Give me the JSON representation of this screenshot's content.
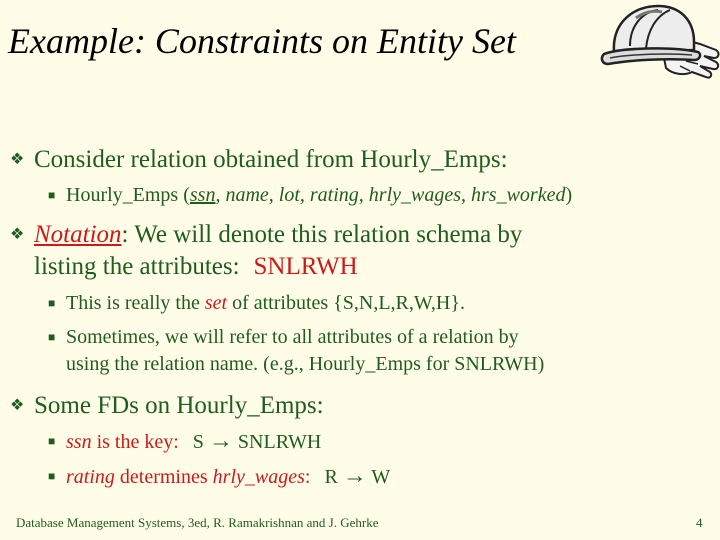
{
  "slide": {
    "title": "Example:  Constraints on Entity Set",
    "bullets": {
      "b1": "Consider relation obtained from Hourly_Emps:",
      "b1_sub": {
        "prefix": "Hourly_Emps (",
        "ssn": "ssn",
        "sep": ", ",
        "attrs": "name, lot, rating, hrly_wages",
        "comma": ", ",
        "last": "hrs_worked",
        "suffix": ")"
      },
      "b2": {
        "notation": "Notation",
        "colon": ":  We will denote this relation schema by",
        "line2": "listing the attributes:",
        "schema": "SNLRWH"
      },
      "b2_sub1": {
        "prefix": "This is really the ",
        "set": "set",
        "suffix": " of attributes {S,N,L,R,W,H}."
      },
      "b2_sub2": {
        "line1": "Sometimes, we will refer to all attributes of a relation by",
        "line2": "using the relation name.  (e.g., Hourly_Emps for SNLRWH)"
      },
      "b3": "Some FDs on Hourly_Emps:",
      "b3_sub1": {
        "ssn": "ssn",
        "is_key": " is the key:",
        "lhs": "S",
        "arrow": "→",
        "rhs": "SNLRWH"
      },
      "b3_sub2": {
        "rating": "rating",
        "determines": " determines ",
        "hrly": "hrly_wages",
        "colon": ":",
        "lhs": "R",
        "arrow": "→",
        "rhs": "W"
      }
    },
    "footer": "Database Management Systems, 3ed, R. Ramakrishnan and J. Gehrke",
    "page_number": "4"
  }
}
